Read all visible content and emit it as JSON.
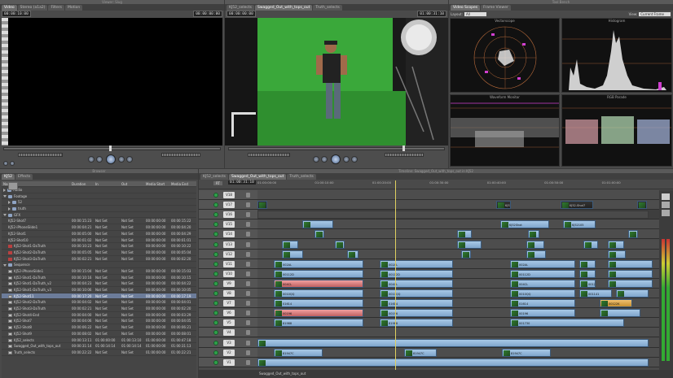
{
  "viewer": {
    "title": "Viewer: Slug",
    "tabs": [
      "Video",
      "Stereo (a1a2)",
      "Filters",
      "Motion"
    ],
    "timecode_left": "00:00:10:00",
    "timecode_right": "00:00:00:00"
  },
  "canvas": {
    "tabs": [
      "KJ52_selects",
      "Swagged_Out_with_tops_out",
      "Truth_selects"
    ],
    "timecode_left": "00:00:00:00",
    "timecode_right": "01:00:31:10"
  },
  "scopes": {
    "title": "Tool Bench",
    "tabs": [
      "Video Scopes",
      "Frame Viewer"
    ],
    "layout_label": "Layout:",
    "layout_value": "All",
    "view_label": "View:",
    "view_value": "Current Frame",
    "panes": [
      "Vectorscope",
      "Histogram",
      "Waveform Monitor",
      "RGB Parade"
    ]
  },
  "browser": {
    "title": "Browser",
    "tabs": [
      "KJ52",
      "Effects"
    ],
    "columns": [
      "Name",
      "Duration",
      "In",
      "Out",
      "Media Start",
      "Media End"
    ],
    "rows": [
      {
        "name": "Audio",
        "kind": "folder",
        "indent": 0,
        "open": false,
        "duration": "",
        "in": "",
        "out": "",
        "mstart": "",
        "mend": ""
      },
      {
        "name": "Footage",
        "kind": "folder",
        "indent": 0,
        "open": true,
        "duration": "",
        "in": "",
        "out": "",
        "mstart": "",
        "mend": ""
      },
      {
        "name": "52",
        "kind": "folder",
        "indent": 1,
        "open": false,
        "duration": "",
        "in": "",
        "out": "",
        "mstart": "",
        "mend": ""
      },
      {
        "name": "truth",
        "kind": "folder",
        "indent": 1,
        "open": false,
        "duration": "",
        "in": "",
        "out": "",
        "mstart": "",
        "mend": ""
      },
      {
        "name": "GFX",
        "kind": "folder",
        "indent": 0,
        "open": true,
        "duration": "",
        "in": "",
        "out": "",
        "mstart": "",
        "mend": ""
      },
      {
        "name": "KJ52-Shot7",
        "kind": "clip",
        "indent": 1,
        "duration": "00:00:15:23",
        "in": "Not Set",
        "out": "Not Set",
        "mstart": "00:00:00:00",
        "mend": "00:00:15:22"
      },
      {
        "name": "KJ52-iPhoneSlide1",
        "kind": "clip",
        "indent": 1,
        "duration": "00:00:04:21",
        "in": "Not Set",
        "out": "Not Set",
        "mstart": "00:00:00:00",
        "mend": "00:00:04:20"
      },
      {
        "name": "KJ52-Shot1",
        "kind": "clip",
        "indent": 1,
        "duration": "00:00:05:00",
        "in": "Not Set",
        "out": "Not Set",
        "mstart": "00:00:00:00",
        "mend": "00:00:04:29"
      },
      {
        "name": "KJ52-Shot10",
        "kind": "clip",
        "indent": 1,
        "duration": "00:00:01:02",
        "in": "Not Set",
        "out": "Not Set",
        "mstart": "00:00:00:00",
        "mend": "00:00:01:01"
      },
      {
        "name": "KJ52-Shot1-DaTruth",
        "kind": "red",
        "indent": 1,
        "duration": "00:00:10:23",
        "in": "Not Set",
        "out": "Not Set",
        "mstart": "00:00:00:00",
        "mend": "00:00:10:22"
      },
      {
        "name": "KJ52-Shot2-DaTruth",
        "kind": "red",
        "indent": 1,
        "duration": "00:00:05:05",
        "in": "Not Set",
        "out": "Not Set",
        "mstart": "00:00:00:00",
        "mend": "00:00:05:04"
      },
      {
        "name": "KJ52-Shot3-DaTruth",
        "kind": "red",
        "indent": 1,
        "duration": "00:00:02:21",
        "in": "Not Set",
        "out": "Not Set",
        "mstart": "00:00:00:00",
        "mend": "00:00:02:20"
      },
      {
        "name": "Sequence",
        "kind": "folder",
        "indent": 0,
        "open": true,
        "duration": "",
        "in": "",
        "out": "",
        "mstart": "",
        "mend": ""
      },
      {
        "name": "KJ52-iPhoneSlide1",
        "kind": "seq",
        "indent": 1,
        "duration": "00:00:15:04",
        "in": "Not Set",
        "out": "Not Set",
        "mstart": "00:00:00:00",
        "mend": "00:00:15:03"
      },
      {
        "name": "KJ52-Shot1-DaTruth",
        "kind": "seq",
        "indent": 1,
        "duration": "00:00:10:16",
        "in": "Not Set",
        "out": "Not Set",
        "mstart": "00:00:00:00",
        "mend": "00:00:10:15"
      },
      {
        "name": "KJ52-Shot1-DaTruth_v2",
        "kind": "seq",
        "indent": 1,
        "duration": "00:00:04:23",
        "in": "Not Set",
        "out": "Not Set",
        "mstart": "00:00:00:00",
        "mend": "00:00:04:22"
      },
      {
        "name": "KJ52-Shot1-DaTruth_v3",
        "kind": "seq",
        "indent": 1,
        "duration": "00:00:10:06",
        "in": "Not Set",
        "out": "Not Set",
        "mstart": "00:00:00:00",
        "mend": "00:00:10:05"
      },
      {
        "name": "KJ52-Shot11",
        "kind": "seq",
        "indent": 1,
        "selected": true,
        "duration": "00:00:17:20",
        "in": "Not Set",
        "out": "Not Set",
        "mstart": "00:00:00:00",
        "mend": "00:00:17:19"
      },
      {
        "name": "KJ52-Shot2-DaTruth",
        "kind": "seq",
        "indent": 1,
        "duration": "00:00:04:02",
        "in": "Not Set",
        "out": "Not Set",
        "mstart": "00:00:00:00",
        "mend": "00:00:04:01"
      },
      {
        "name": "KJ52-Shot3-DaTruth",
        "kind": "seq",
        "indent": 1,
        "duration": "00:00:02:21",
        "in": "Not Set",
        "out": "Not Set",
        "mstart": "00:00:00:00",
        "mend": "00:00:02:20"
      },
      {
        "name": "KJ52-Shot4-End",
        "kind": "seq",
        "indent": 1,
        "duration": "00:00:04:00",
        "in": "Not Set",
        "out": "Not Set",
        "mstart": "00:00:00:00",
        "mend": "00:00:03:29"
      },
      {
        "name": "KJ52-Shot7",
        "kind": "seq",
        "indent": 1,
        "duration": "00:00:04:06",
        "in": "Not Set",
        "out": "Not Set",
        "mstart": "00:00:00:00",
        "mend": "00:00:04:05"
      },
      {
        "name": "KJ52-Shot8",
        "kind": "seq",
        "indent": 1,
        "duration": "00:00:06:22",
        "in": "Not Set",
        "out": "Not Set",
        "mstart": "00:00:00:00",
        "mend": "00:00:06:21"
      },
      {
        "name": "KJ52-Shot9",
        "kind": "seq",
        "indent": 1,
        "duration": "00:00:08:02",
        "in": "Not Set",
        "out": "Not Set",
        "mstart": "00:00:00:00",
        "mend": "00:00:08:01"
      },
      {
        "name": "KJ52_selects",
        "kind": "seq",
        "indent": 1,
        "duration": "00:00:13:11",
        "in": "01:00:00:00",
        "out": "01:00:13:10",
        "mstart": "01:00:00:00",
        "mend": "01:00:47:18"
      },
      {
        "name": "Swagged_Out_with_tops_out",
        "kind": "seq",
        "indent": 1,
        "duration": "00:00:31:14",
        "in": "01:00:14:14",
        "out": "01:00:14:14",
        "mstart": "01:00:00:00",
        "mend": "01:00:31:13"
      },
      {
        "name": "Truth_selects",
        "kind": "seq",
        "indent": 1,
        "duration": "00:00:22:22",
        "in": "Not Set",
        "out": "Not Set",
        "mstart": "01:00:00:00",
        "mend": "01:00:22:21"
      }
    ]
  },
  "timeline": {
    "title": "Timeline: Swagged_Out_with_tops_out in KJ52",
    "tabs": [
      "KJ52_selects",
      "Swagged_Out_with_tops_out",
      "Truth_selects"
    ],
    "rt_label": "RT",
    "timecode": "01:00:31:10",
    "ruler": [
      "01:00:00:00",
      "01:00:10:00",
      "01:00:20:00",
      "01:00:30:00",
      "01:00:40:00",
      "01:00:50:00",
      "01:01:00:00"
    ],
    "tracks": [
      "V18",
      "V17",
      "V16",
      "V15",
      "V14",
      "V13",
      "V12",
      "V11",
      "V10",
      "V9",
      "V8",
      "V7",
      "V6",
      "V5",
      "V4",
      "V3",
      "V2",
      "V1"
    ],
    "status": "Swagged_Out_with_tops_out"
  }
}
